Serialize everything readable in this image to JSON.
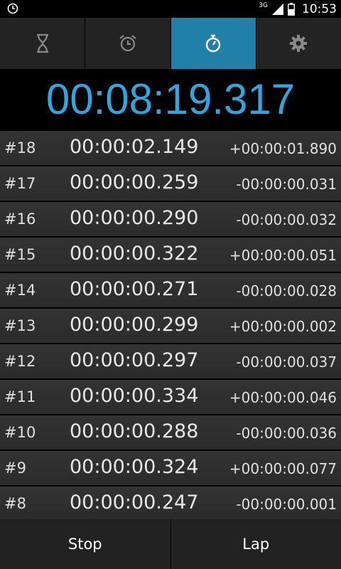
{
  "status_bar": {
    "network": "3G",
    "time": "10:53"
  },
  "tabs": [
    {
      "icon": "hourglass-icon",
      "active": false
    },
    {
      "icon": "alarm-clock-icon",
      "active": false
    },
    {
      "icon": "stopwatch-icon",
      "active": true
    },
    {
      "icon": "gear-icon",
      "active": false
    }
  ],
  "stopwatch": {
    "elapsed": "00:08:19.317"
  },
  "laps": [
    {
      "num": "#18",
      "time": "00:00:02.149",
      "diff": "+00:00:01.890"
    },
    {
      "num": "#17",
      "time": "00:00:00.259",
      "diff": "-00:00:00.031"
    },
    {
      "num": "#16",
      "time": "00:00:00.290",
      "diff": "-00:00:00.032"
    },
    {
      "num": "#15",
      "time": "00:00:00.322",
      "diff": "+00:00:00.051"
    },
    {
      "num": "#14",
      "time": "00:00:00.271",
      "diff": "-00:00:00.028"
    },
    {
      "num": "#13",
      "time": "00:00:00.299",
      "diff": "+00:00:00.002"
    },
    {
      "num": "#12",
      "time": "00:00:00.297",
      "diff": "-00:00:00.037"
    },
    {
      "num": "#11",
      "time": "00:00:00.334",
      "diff": "+00:00:00.046"
    },
    {
      "num": "#10",
      "time": "00:00:00.288",
      "diff": "-00:00:00.036"
    },
    {
      "num": "#9",
      "time": "00:00:00.324",
      "diff": "+00:00:00.077"
    },
    {
      "num": "#8",
      "time": "00:00:00.247",
      "diff": "-00:00:00.001"
    }
  ],
  "buttons": {
    "stop": "Stop",
    "lap": "Lap"
  },
  "colors": {
    "accent": "#2ea6e0",
    "active_tab": "#217fa8"
  }
}
